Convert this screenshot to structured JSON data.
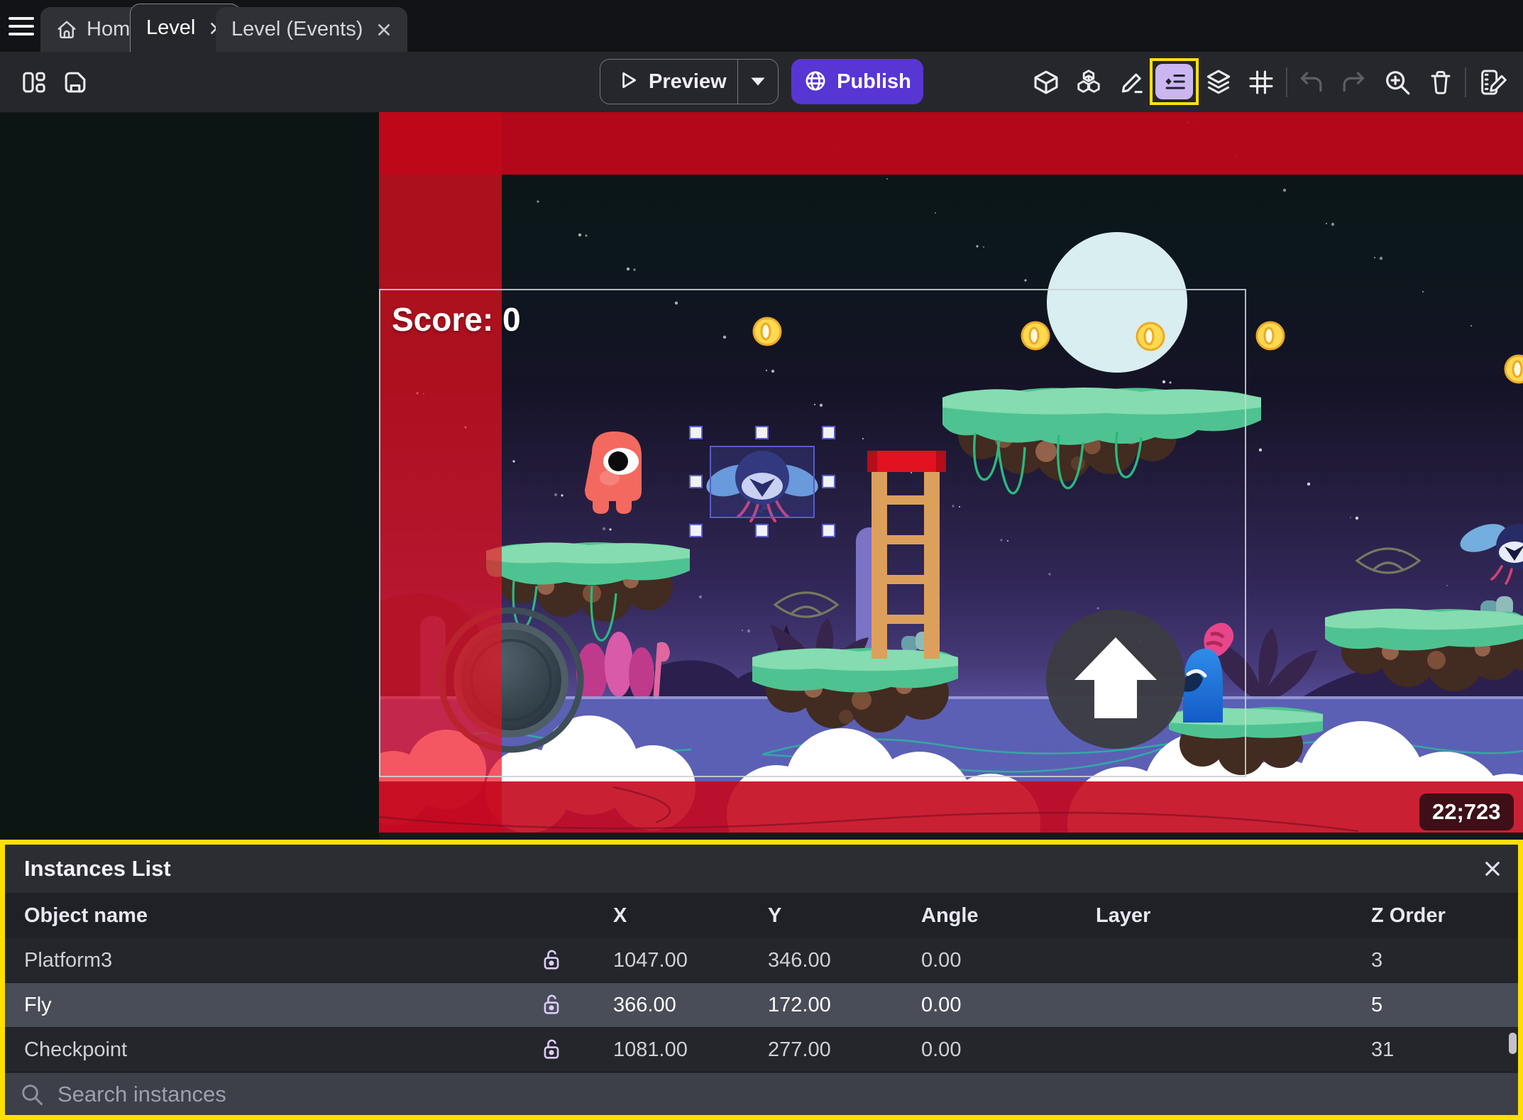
{
  "window": {
    "tabs": [
      {
        "label": "Home"
      },
      {
        "label": "Level"
      },
      {
        "label": "Level (Events)"
      }
    ]
  },
  "toolbar": {
    "preview_label": "Preview",
    "publish_label": "Publish"
  },
  "scene": {
    "score_text": "Score: 0",
    "coords_badge": "22;723",
    "selected_instance": "Fly"
  },
  "instances_panel": {
    "title": "Instances List",
    "columns": [
      "Object name",
      "X",
      "Y",
      "Angle",
      "Layer",
      "Z Order"
    ],
    "rows": [
      {
        "name": "Platform3",
        "x": "1047.00",
        "y": "346.00",
        "angle": "0.00",
        "layer": "",
        "z_order": "3"
      },
      {
        "name": "Fly",
        "x": "366.00",
        "y": "172.00",
        "angle": "0.00",
        "layer": "",
        "z_order": "5"
      },
      {
        "name": "Checkpoint",
        "x": "1081.00",
        "y": "277.00",
        "angle": "0.00",
        "layer": "",
        "z_order": "31"
      }
    ],
    "search_placeholder": "Search instances"
  },
  "colors": {
    "accent_purple": "#5736d3",
    "highlight_yellow": "#ffdf00",
    "band_red": "#bf071a",
    "selection_blue": "#5a62cc",
    "scene_water": "#5b60b5"
  }
}
